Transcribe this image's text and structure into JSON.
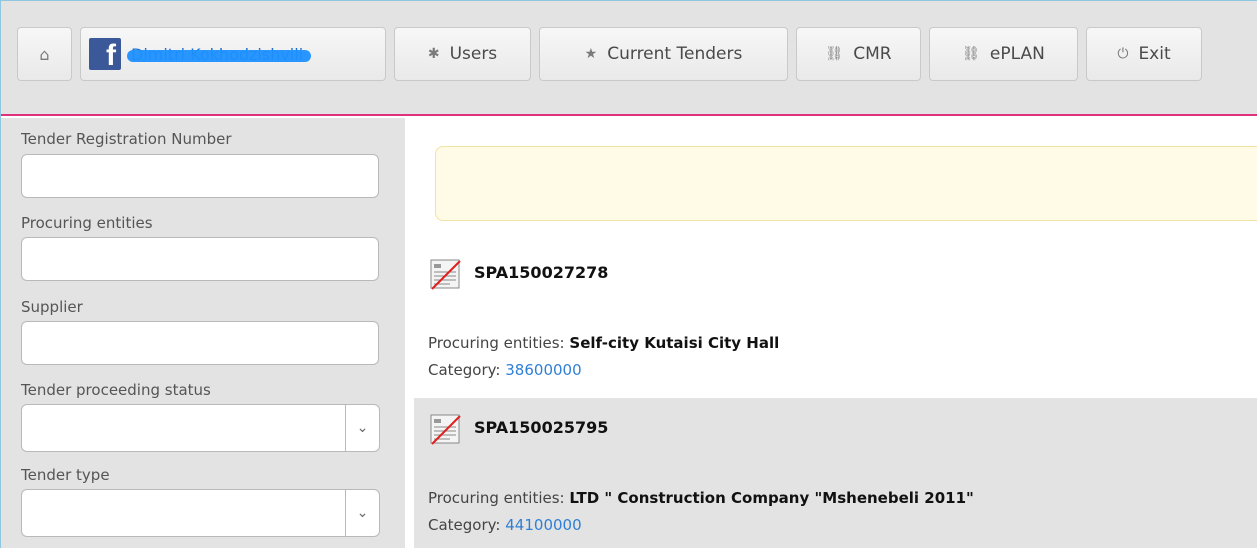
{
  "nav": {
    "home_icon": "home-icon",
    "fb_label": "Dimitri Kokhodzishvili",
    "users_label": "Users",
    "tenders_label": "Current Tenders",
    "cmr_label": "CMR",
    "eplan_label": "ePLAN",
    "exit_label": "Exit"
  },
  "filters": {
    "registration_label": "Tender Registration Number",
    "procuring_label": "Procuring entities",
    "supplier_label": "Supplier",
    "status_label": "Tender proceeding status",
    "type_label": "Tender type"
  },
  "results": [
    {
      "id": "SPA150027278",
      "procuring_label": "Procuring entities:",
      "procuring_value": "Self-city Kutaisi City Hall",
      "category_label": "Category:",
      "category_value": "38600000"
    },
    {
      "id": "SPA150025795",
      "procuring_label": "Procuring entities:",
      "procuring_value": "LTD \" Construction Company \"Mshenebeli 2011\"",
      "category_label": "Category:",
      "category_value": "44100000"
    }
  ],
  "colors": {
    "accent_border": "#e0317e",
    "link": "#2f7fd6",
    "facebook": "#3b5998"
  }
}
